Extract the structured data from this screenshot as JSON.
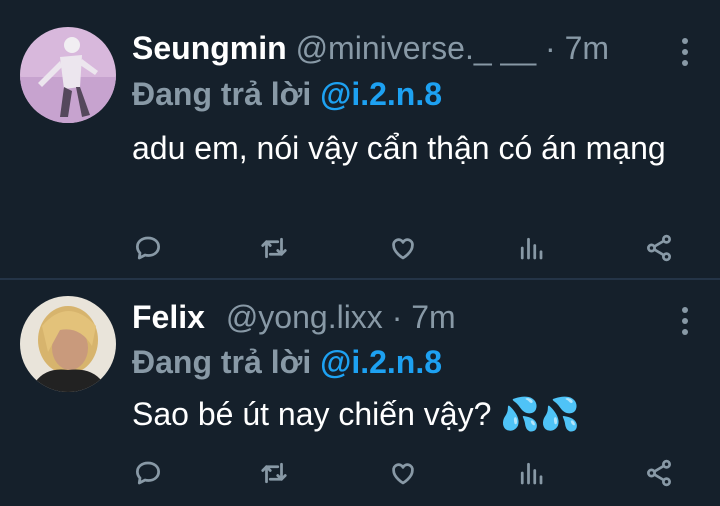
{
  "tweets": [
    {
      "name": "Seungmin",
      "handle": "@miniverse._ __",
      "separator": "·",
      "time": "7m",
      "reply_prefix": "Đang trả lời",
      "reply_to": "@i.2.n.8",
      "text": "adu em, nói vậy cẩn thận có án mạng"
    },
    {
      "name": "Felix",
      "handle": "@yong.lixx",
      "separator": "·",
      "time": "7m",
      "reply_prefix": "Đang trả lời",
      "reply_to": "@i.2.n.8",
      "text": "Sao bé út nay chiến vậy?",
      "emoji": "💦💦"
    }
  ],
  "colors": {
    "background": "#15202b",
    "muted": "#8899a6",
    "accent": "#1da1f2",
    "divider": "#243447"
  },
  "icons": [
    "reply-icon",
    "retweet-icon",
    "like-icon",
    "analytics-icon",
    "share-icon",
    "more-icon"
  ]
}
